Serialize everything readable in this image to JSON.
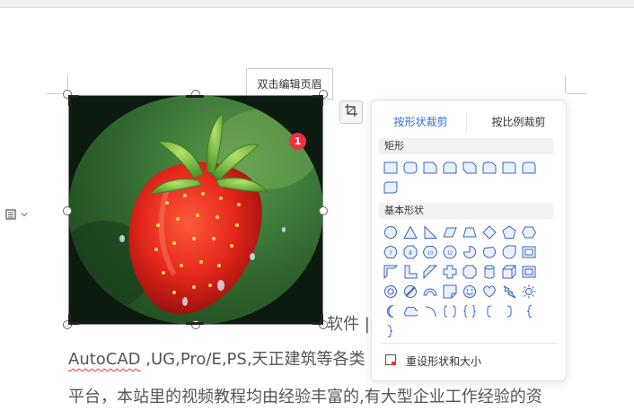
{
  "header_tooltip": "双击编辑页眉",
  "badge_count": "1",
  "crop_panel": {
    "tab_shape": "按形状裁剪",
    "tab_ratio": "按比例裁剪",
    "section_rect": "矩形",
    "section_basic": "基本形状",
    "reset_label": "重设形状和大小"
  },
  "document": {
    "line1_fragment": "软件 |",
    "line2_autocad": "AutoCAD",
    "line2_rest": " ,UG,Pro/E,PS,天正建筑等各类",
    "line3": "平台，本站里的视频教程均由经验丰富的,有大型企业工作经验的资"
  },
  "colors": {
    "accent": "#2f6ed9",
    "shape_stroke": "#3b63c4",
    "shape_fill": "#eaf0fb",
    "badge": "#f0313f"
  },
  "icons": {
    "left_tool": "text-wrap-icon",
    "crop_button": "crop-icon",
    "reset": "reset-shape-icon"
  }
}
